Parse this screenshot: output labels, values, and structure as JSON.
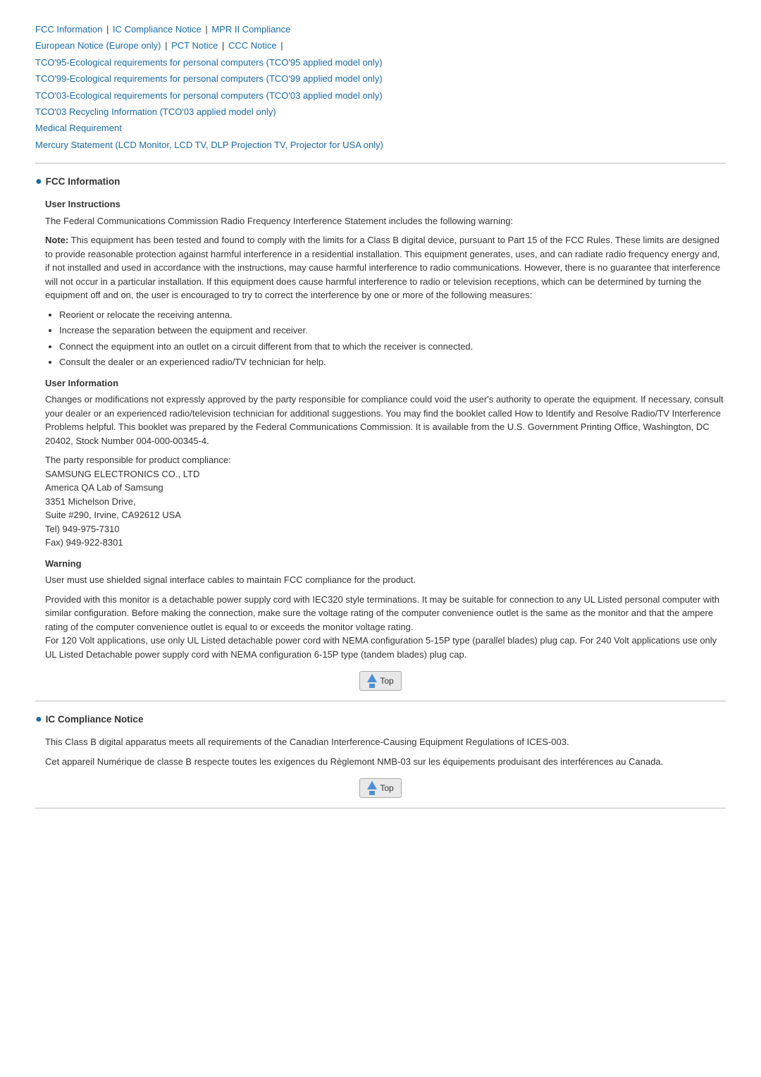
{
  "nav": {
    "links": [
      {
        "label": "FCC Information",
        "sep_after": "|"
      },
      {
        "label": "IC Compliance Notice",
        "sep_after": "|"
      },
      {
        "label": "MPR II Compliance",
        "sep_after": ""
      },
      {
        "label": "European Notice (Europe only)",
        "sep_after": "|"
      },
      {
        "label": "PCT Notice",
        "sep_after": "|"
      },
      {
        "label": "CCC Notice",
        "sep_after": "|"
      },
      {
        "label": "TCO'95-Ecological requirements for personal computers (TCO'95 applied model only)",
        "sep_after": ""
      },
      {
        "label": "TCO'99-Ecological requirements for personal computers (TCO'99 applied model only)",
        "sep_after": ""
      },
      {
        "label": "TCO'03-Ecological requirements for personal computers (TCO'03 applied model only)",
        "sep_after": ""
      },
      {
        "label": "TCO'03 Recycling Information (TCO'03 applied model only)",
        "sep_after": ""
      },
      {
        "label": "Medical Requirement",
        "sep_after": ""
      },
      {
        "label": "Mercury Statement (LCD Monitor, LCD TV, DLP Projection TV, Projector for USA only)",
        "sep_after": ""
      }
    ]
  },
  "fcc_section": {
    "title": "FCC Information",
    "user_instructions": {
      "subtitle": "User Instructions",
      "intro": "The Federal Communications Commission Radio Frequency Interference Statement includes the following warning:",
      "note_label": "Note:",
      "note_text": " This equipment has been tested and found to comply with the limits for a Class B digital device, pursuant to Part 15 of the FCC Rules. These limits are designed to provide reasonable protection against harmful interference in a residential installation. This equipment generates, uses, and can radiate radio frequency energy and, if not installed and used in accordance with the instructions, may cause harmful interference to radio communications. However, there is no guarantee that interference will not occur in a particular installation. If this equipment does cause harmful interference to radio or television receptions, which can be determined by turning the equipment off and on, the user is encouraged to try to correct the interference by one or more of the following measures:",
      "bullets": [
        "Reorient or relocate the receiving antenna.",
        "Increase the separation between the equipment and receiver.",
        "Connect the equipment into an outlet on a circuit different from that to which the receiver is connected.",
        "Consult the dealer or an experienced radio/TV technician for help."
      ]
    },
    "user_information": {
      "subtitle": "User Information",
      "para1": "Changes or modifications not expressly approved by the party responsible for compliance could void the user's authority to operate the equipment. If necessary, consult your dealer or an experienced radio/television technician for additional suggestions. You may find the booklet called How to Identify and Resolve Radio/TV Interference Problems helpful. This booklet was prepared by the Federal Communications Commission. It is available from the U.S. Government Printing Office, Washington, DC 20402, Stock Number 004-000-00345-4.",
      "para2": "The party responsible for product compliance:\nSAMSUNG ELECTRONICS CO., LTD\nAmerica QA Lab of Samsung\n3351 Michelson Drive,\nSuite #290, Irvine, CA92612 USA\nTel) 949-975-7310\nFax) 949-922-8301"
    },
    "warning": {
      "subtitle": "Warning",
      "para1": "User must use shielded signal interface cables to maintain FCC compliance for the product.",
      "para2": "Provided with this monitor is a detachable power supply cord with IEC320 style terminations. It may be suitable for connection to any UL Listed personal computer with similar configuration. Before making the connection, make sure the voltage rating of the computer convenience outlet is the same as the monitor and that the ampere rating of the computer convenience outlet is equal to or exceeds the monitor voltage rating.\nFor 120 Volt applications, use only UL Listed detachable power cord with NEMA configuration 5-15P type (parallel blades) plug cap. For 240 Volt applications use only UL Listed Detachable power supply cord with NEMA configuration 6-15P type (tandem blades) plug cap."
    },
    "top_button_label": "Top"
  },
  "ic_section": {
    "title": "IC Compliance Notice",
    "para1": "This Class B digital apparatus meets all requirements of the Canadian Interference-Causing Equipment Regulations of ICES-003.",
    "para2": "Cet appareil Numérique de classe B respecte toutes les exigences du Règlemont NMB-03 sur les équipements produisant des interférences au Canada.",
    "top_button_label": "Top"
  }
}
